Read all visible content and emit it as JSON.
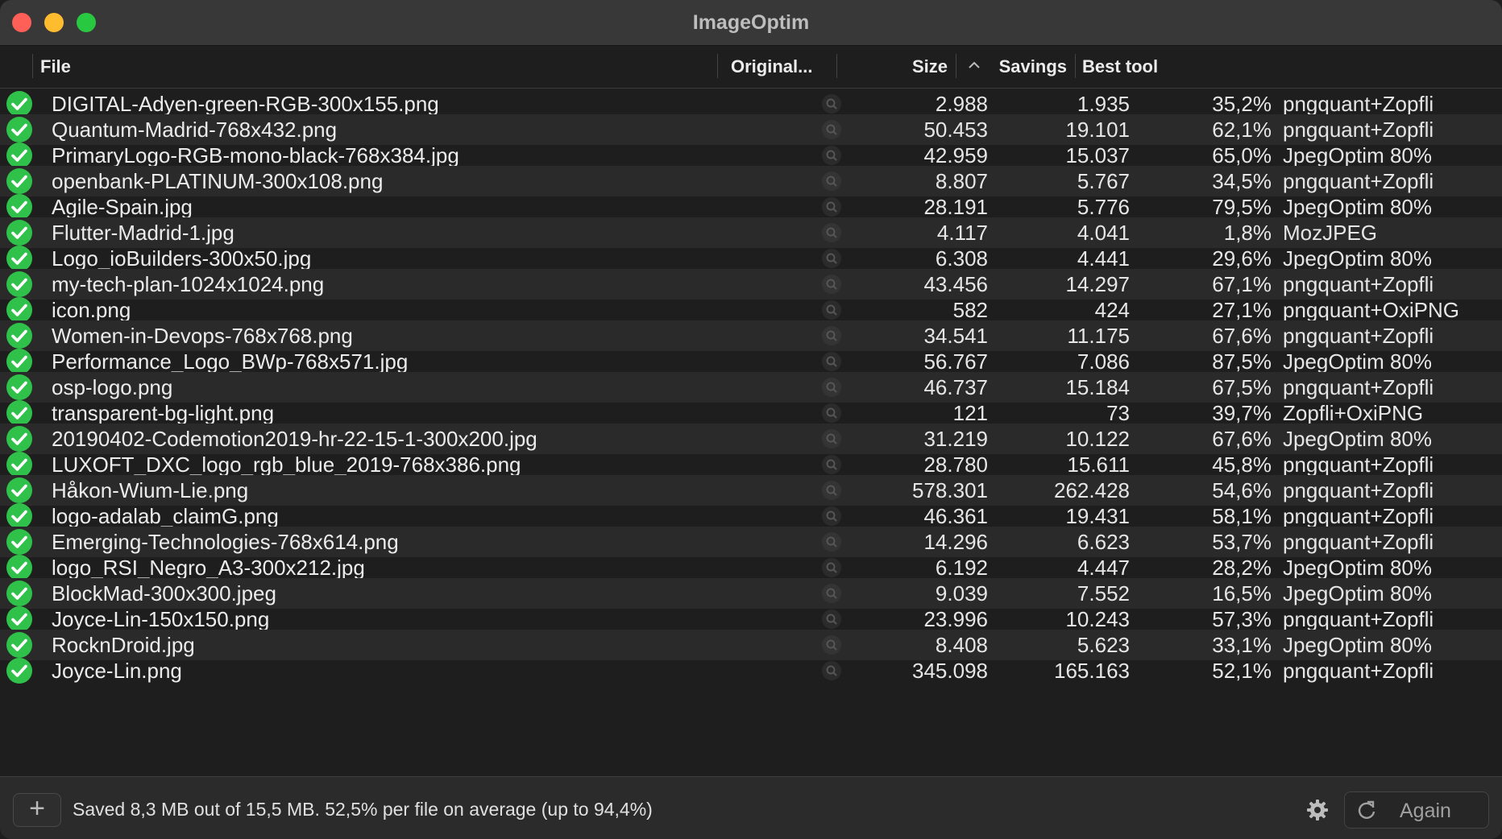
{
  "window": {
    "title": "ImageOptim"
  },
  "columns": {
    "file": "File",
    "original": "Original...",
    "size": "Size",
    "savings": "Savings",
    "best_tool": "Best tool"
  },
  "rows": [
    {
      "file": "DIGITAL-Adyen-green-RGB-300x155.png",
      "original": "2.988",
      "size": "1.935",
      "savings": "35,2%",
      "tool": "pngquant+Zopfli"
    },
    {
      "file": "Quantum-Madrid-768x432.png",
      "original": "50.453",
      "size": "19.101",
      "savings": "62,1%",
      "tool": "pngquant+Zopfli"
    },
    {
      "file": "PrimaryLogo-RGB-mono-black-768x384.jpg",
      "original": "42.959",
      "size": "15.037",
      "savings": "65,0%",
      "tool": "JpegOptim 80%"
    },
    {
      "file": "openbank-PLATINUM-300x108.png",
      "original": "8.807",
      "size": "5.767",
      "savings": "34,5%",
      "tool": "pngquant+Zopfli"
    },
    {
      "file": "Agile-Spain.jpg",
      "original": "28.191",
      "size": "5.776",
      "savings": "79,5%",
      "tool": "JpegOptim 80%"
    },
    {
      "file": "Flutter-Madrid-1.jpg",
      "original": "4.117",
      "size": "4.041",
      "savings": "1,8%",
      "tool": "MozJPEG"
    },
    {
      "file": "Logo_ioBuilders-300x50.jpg",
      "original": "6.308",
      "size": "4.441",
      "savings": "29,6%",
      "tool": "JpegOptim 80%"
    },
    {
      "file": "my-tech-plan-1024x1024.png",
      "original": "43.456",
      "size": "14.297",
      "savings": "67,1%",
      "tool": "pngquant+Zopfli"
    },
    {
      "file": "icon.png",
      "original": "582",
      "size": "424",
      "savings": "27,1%",
      "tool": "pngquant+OxiPNG"
    },
    {
      "file": "Women-in-Devops-768x768.png",
      "original": "34.541",
      "size": "11.175",
      "savings": "67,6%",
      "tool": "pngquant+Zopfli"
    },
    {
      "file": "Performance_Logo_BWp-768x571.jpg",
      "original": "56.767",
      "size": "7.086",
      "savings": "87,5%",
      "tool": "JpegOptim 80%"
    },
    {
      "file": "osp-logo.png",
      "original": "46.737",
      "size": "15.184",
      "savings": "67,5%",
      "tool": "pngquant+Zopfli"
    },
    {
      "file": "transparent-bg-light.png",
      "original": "121",
      "size": "73",
      "savings": "39,7%",
      "tool": "Zopfli+OxiPNG"
    },
    {
      "file": "20190402-Codemotion2019-hr-22-15-1-300x200.jpg",
      "original": "31.219",
      "size": "10.122",
      "savings": "67,6%",
      "tool": "JpegOptim 80%"
    },
    {
      "file": "LUXOFT_DXC_logo_rgb_blue_2019-768x386.png",
      "original": "28.780",
      "size": "15.611",
      "savings": "45,8%",
      "tool": "pngquant+Zopfli"
    },
    {
      "file": "Håkon-Wium-Lie.png",
      "original": "578.301",
      "size": "262.428",
      "savings": "54,6%",
      "tool": "pngquant+Zopfli"
    },
    {
      "file": "logo-adalab_claimG.png",
      "original": "46.361",
      "size": "19.431",
      "savings": "58,1%",
      "tool": "pngquant+Zopfli"
    },
    {
      "file": "Emerging-Technologies-768x614.png",
      "original": "14.296",
      "size": "6.623",
      "savings": "53,7%",
      "tool": "pngquant+Zopfli"
    },
    {
      "file": "logo_RSI_Negro_A3-300x212.jpg",
      "original": "6.192",
      "size": "4.447",
      "savings": "28,2%",
      "tool": "JpegOptim 80%"
    },
    {
      "file": "BlockMad-300x300.jpeg",
      "original": "9.039",
      "size": "7.552",
      "savings": "16,5%",
      "tool": "JpegOptim 80%"
    },
    {
      "file": "Joyce-Lin-150x150.png",
      "original": "23.996",
      "size": "10.243",
      "savings": "57,3%",
      "tool": "pngquant+Zopfli"
    },
    {
      "file": "RocknDroid.jpg",
      "original": "8.408",
      "size": "5.623",
      "savings": "33,1%",
      "tool": "JpegOptim 80%"
    },
    {
      "file": "Joyce-Lin.png",
      "original": "345.098",
      "size": "165.163",
      "savings": "52,1%",
      "tool": "pngquant+Zopfli"
    }
  ],
  "footer": {
    "add_label": "+",
    "status": "Saved 8,3 MB out of 15,5 MB. 52,5% per file on average (up to 94,4%)",
    "again_label": "Again"
  },
  "colors": {
    "check": "#2fc14a",
    "background": "#1e1e1e",
    "row_alt": "#2a2a2a"
  }
}
